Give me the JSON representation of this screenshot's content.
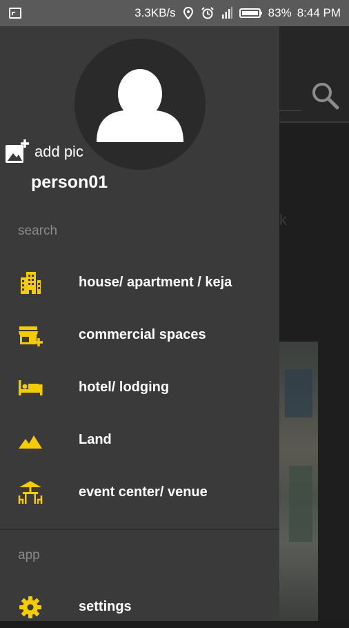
{
  "status_bar": {
    "network_speed": "3.3KB/s",
    "battery": "83%",
    "time": "8:44 PM",
    "icons": [
      "screenshot-icon",
      "location-icon",
      "alarm-icon",
      "signal-icon",
      "battery-icon"
    ]
  },
  "drawer": {
    "profile": {
      "add_pic_label": "add pic",
      "username": "person01"
    },
    "sections": {
      "search": "search",
      "app": "app"
    },
    "search_items": [
      {
        "label": "house/ apartment / keja",
        "icon": "building-icon"
      },
      {
        "label": "commercial spaces",
        "icon": "store-add-icon"
      },
      {
        "label": "hotel/ lodging",
        "icon": "hotel-bed-icon"
      },
      {
        "label": "Land",
        "icon": "terrain-icon"
      },
      {
        "label": "event center/ venue",
        "icon": "event-venue-icon"
      }
    ],
    "app_items": [
      {
        "label": "settings",
        "icon": "gear-icon"
      }
    ]
  },
  "background": {
    "partial_text": "k"
  },
  "colors": {
    "drawer_bg": "#3a3a3a",
    "accent_yellow": "#f5cc00",
    "status_bar_bg": "#5a5a5a",
    "text_white": "#ffffff",
    "section_gray": "#8a8a8a"
  }
}
